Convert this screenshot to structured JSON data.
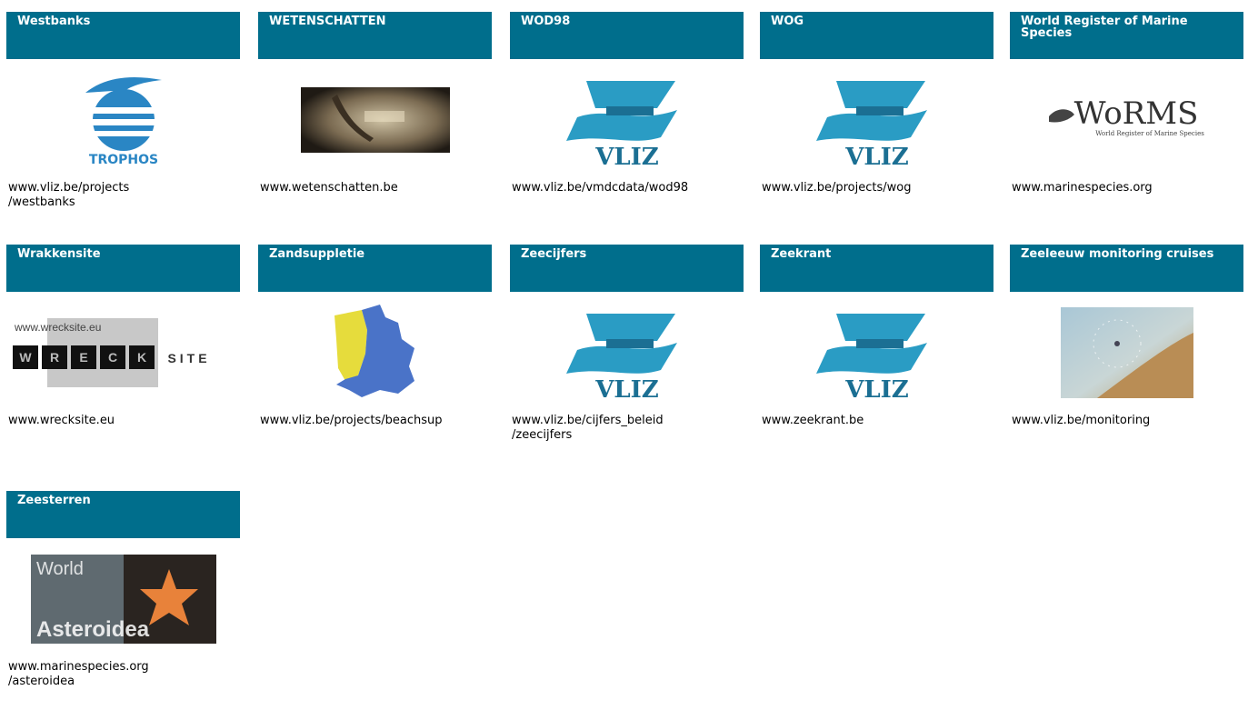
{
  "cards": [
    {
      "title": "Westbanks",
      "url1": "www.vliz.be/projects",
      "url2": "/westbanks",
      "logo": "trophos-logo",
      "logo_text": "TROPHOS"
    },
    {
      "title": "WETENSCHATTEN",
      "url1": "www.wetenschatten.be",
      "url2": "",
      "logo": "wetenschatten-logo"
    },
    {
      "title": "WOD98",
      "url1": "www.vliz.be/vmdcdata/wod98",
      "url2": "",
      "logo": "vliz-logo",
      "logo_text": "VLIZ"
    },
    {
      "title": "WOG",
      "url1": "www.vliz.be/projects/wog",
      "url2": "",
      "logo": "vliz-logo",
      "logo_text": "VLIZ"
    },
    {
      "title": "World Register of Marine Species",
      "url1": "www.marinespecies.org",
      "url2": "",
      "logo": "worms-logo",
      "logo_text": "WoRMS",
      "logo_subtext": "World Register of Marine Species"
    },
    {
      "title": "Wrakkensite",
      "url1": "www.wrecksite.eu",
      "url2": "",
      "logo": "wrecksite-logo",
      "logo_text": "www.wrecksite.eu",
      "logo_letters": [
        "W",
        "R",
        "E",
        "C",
        "K"
      ],
      "logo_tail": "SITE"
    },
    {
      "title": "Zandsuppletie",
      "url1": "www.vliz.be/projects/beachsup",
      "url2": "",
      "logo": "beachsup-map-logo"
    },
    {
      "title": "Zeecijfers",
      "url1": "www.vliz.be/cijfers_beleid",
      "url2": "/zeecijfers",
      "logo": "vliz-logo",
      "logo_text": "VLIZ"
    },
    {
      "title": "Zeekrant",
      "url1": "www.zeekrant.be",
      "url2": "",
      "logo": "vliz-logo",
      "logo_text": "VLIZ"
    },
    {
      "title": "Zeeleeuw monitoring cruises",
      "url1": "www.vliz.be/monitoring",
      "url2": "",
      "logo": "monitoring-logo"
    },
    {
      "title": "Zeesterren",
      "url1": "www.marinespecies.org",
      "url2": "/asteroidea",
      "logo": "asteroidea-logo",
      "logo_text1": "World",
      "logo_text2": "Asteroidea"
    }
  ],
  "colors": {
    "header_bg": "#006e8c",
    "header_text": "#ffffff",
    "vliz_blue": "#2a9cc4",
    "vliz_dark": "#1b6f93"
  }
}
